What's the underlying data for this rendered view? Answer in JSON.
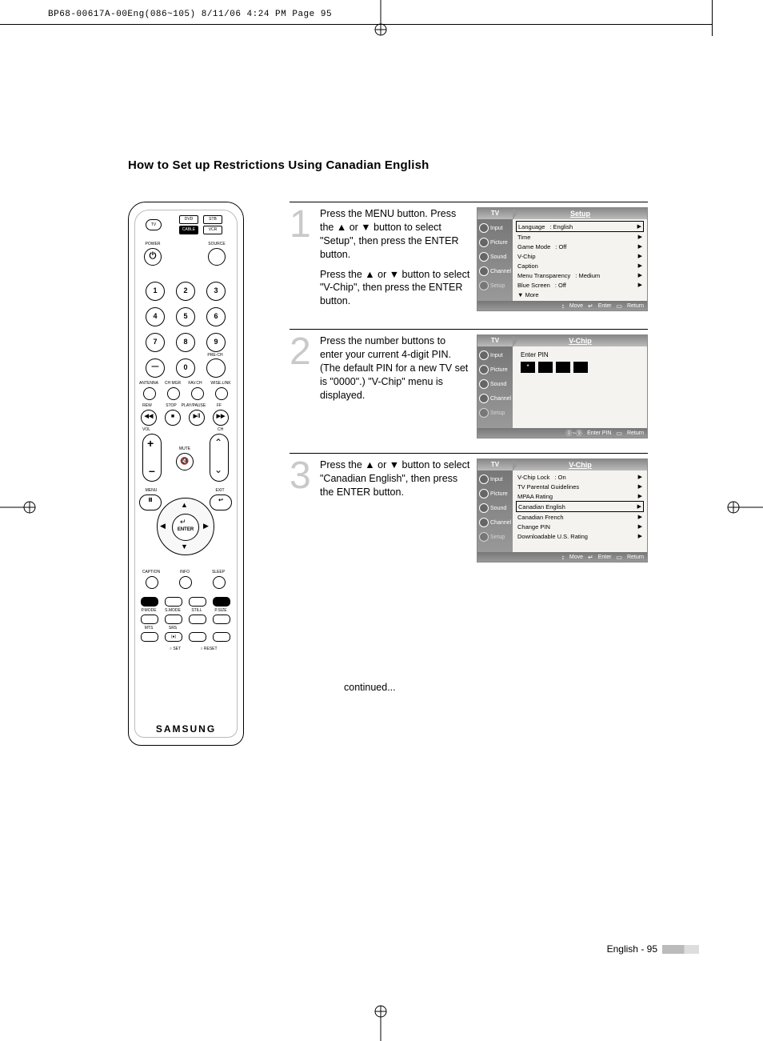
{
  "header_line": "BP68-00617A-00Eng(086~105)  8/11/06  4:24 PM  Page 95",
  "title": "How to Set up Restrictions Using Canadian English",
  "remote": {
    "tv": "TV",
    "dvd": "DVD",
    "stb": "STB",
    "cable": "CABLE",
    "vcr": "VCR",
    "power": "POWER",
    "source": "SOURCE",
    "n1": "1",
    "n2": "2",
    "n3": "3",
    "n4": "4",
    "n5": "5",
    "n6": "6",
    "n7": "7",
    "n8": "8",
    "n9": "9",
    "n0": "0",
    "prech": "PRE-CH",
    "antenna": "ANTENNA",
    "chmgr": "CH MGR",
    "favch": "FAV.CH",
    "wiselink": "WISE.LINK",
    "rew": "REW",
    "stop": "STOP",
    "play": "PLAY/PAUSE",
    "ff": "FF",
    "vol": "VOL",
    "ch": "CH",
    "mute": "MUTE",
    "menu": "MENU",
    "exit": "EXIT",
    "enter": "ENTER",
    "caption": "CAPTION",
    "info": "INFO",
    "sleep": "SLEEP",
    "pmode": "P.MODE",
    "smode": "S.MODE",
    "still": "STILL",
    "psize": "P.SIZE",
    "mts": "MTS",
    "srs": "SRS",
    "set": "SET",
    "reset": "RESET",
    "brand": "SAMSUNG"
  },
  "steps": [
    {
      "num": "1",
      "paras": [
        "Press the MENU button. Press the ▲ or ▼ button to select \"Setup\", then press the ENTER button.",
        "Press the ▲ or ▼ button to select \"V-Chip\", then press the ENTER button."
      ],
      "osd": {
        "left_tab": "TV",
        "right_tab": "Setup",
        "side": [
          "Input",
          "Picture",
          "Sound",
          "Channel",
          "Setup"
        ],
        "rows": [
          {
            "label": "Language",
            "val": ": English",
            "sel": true
          },
          {
            "label": "Time",
            "val": ""
          },
          {
            "label": "Game Mode",
            "val": ": Off"
          },
          {
            "label": "V-Chip",
            "val": ""
          },
          {
            "label": "Caption",
            "val": ""
          },
          {
            "label": "Menu Transparency",
            "val": ": Medium"
          },
          {
            "label": "Blue Screen",
            "val": ": Off"
          },
          {
            "label": "▼ More",
            "val": "",
            "noarrow": true
          }
        ],
        "foot": [
          "Move",
          "Enter",
          "Return"
        ],
        "foot_syms": [
          "↕",
          "↵",
          "▭"
        ]
      }
    },
    {
      "num": "2",
      "paras": [
        "Press the number buttons to enter your current 4-digit PIN. (The default PIN for a new TV set is \"0000\".) \"V-Chip\" menu is displayed."
      ],
      "osd": {
        "left_tab": "TV",
        "right_tab": "V-Chip",
        "side": [
          "Input",
          "Picture",
          "Sound",
          "Channel",
          "Setup"
        ],
        "pin_label": "Enter PIN",
        "pin": [
          "*",
          "",
          "",
          ""
        ],
        "foot": [
          "Enter PIN",
          "Return"
        ],
        "foot_syms": [
          "⓪~⑨",
          "▭"
        ]
      }
    },
    {
      "num": "3",
      "paras": [
        "Press the ▲ or ▼ button to select \"Canadian English\", then press the ENTER button."
      ],
      "osd": {
        "left_tab": "TV",
        "right_tab": "V-Chip",
        "side": [
          "Input",
          "Picture",
          "Sound",
          "Channel",
          "Setup"
        ],
        "rows": [
          {
            "label": "V-Chip Lock",
            "val": ": On"
          },
          {
            "label": "TV Parental Guidelines",
            "val": ""
          },
          {
            "label": "MPAA Rating",
            "val": ""
          },
          {
            "label": "Canadian English",
            "val": "",
            "sel": true
          },
          {
            "label": "Canadian French",
            "val": ""
          },
          {
            "label": "Change PIN",
            "val": ""
          },
          {
            "label": "Downloadable U.S. Rating",
            "val": ""
          }
        ],
        "foot": [
          "Move",
          "Enter",
          "Return"
        ],
        "foot_syms": [
          "↕",
          "↵",
          "▭"
        ]
      }
    }
  ],
  "continued": "continued...",
  "footer": "English - 95"
}
